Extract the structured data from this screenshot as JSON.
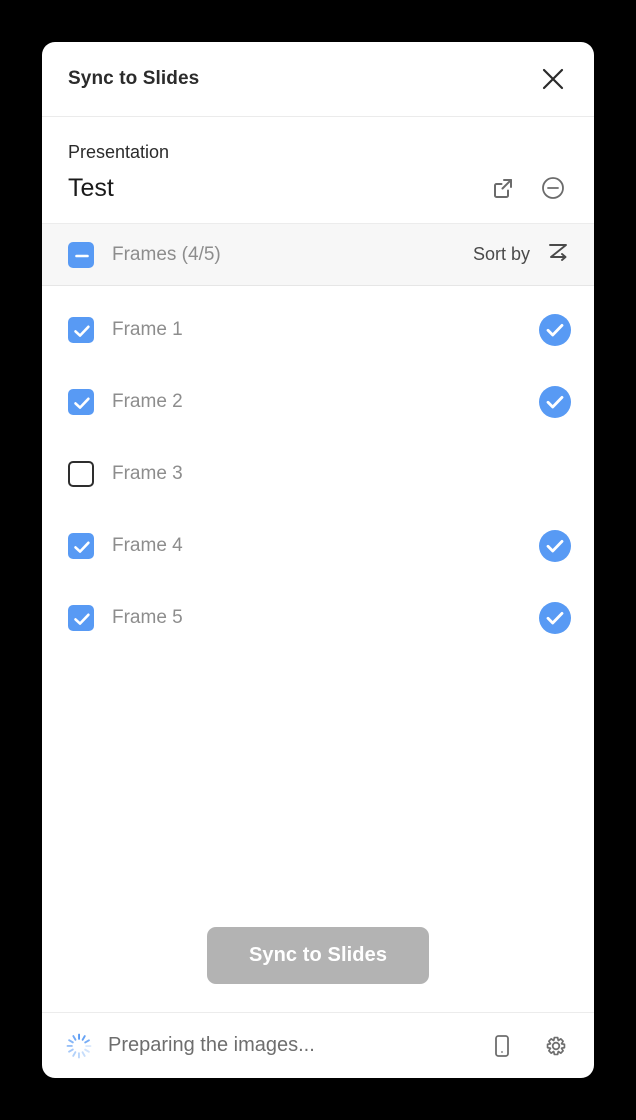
{
  "window": {
    "title": "Sync to Slides",
    "close_icon": "close-icon"
  },
  "presentation": {
    "label": "Presentation",
    "name": "Test",
    "open_external_icon": "external-link-icon",
    "remove_icon": "minus-circle-icon"
  },
  "frames_header": {
    "title": "Frames (4/5)",
    "checkbox_state": "indeterminate",
    "sort_label": "Sort by",
    "sort_icon": "sort-z-arrow-icon"
  },
  "frames": [
    {
      "label": "Frame 1",
      "checked": true,
      "synced": true
    },
    {
      "label": "Frame 2",
      "checked": true,
      "synced": true
    },
    {
      "label": "Frame 3",
      "checked": false,
      "synced": false
    },
    {
      "label": "Frame 4",
      "checked": true,
      "synced": true
    },
    {
      "label": "Frame 5",
      "checked": true,
      "synced": true
    }
  ],
  "action": {
    "sync_label": "Sync to Slides",
    "disabled": true
  },
  "statusbar": {
    "message": "Preparing the images...",
    "spinner_icon": "loading-spinner-icon",
    "device_icon": "mobile-device-icon",
    "settings_icon": "gear-icon"
  },
  "colors": {
    "accent_blue": "#589af4",
    "disabled_button": "#b3b3b3",
    "header_band": "#f7f7f7",
    "muted_text": "#8d8d8d",
    "backdrop": "#000000"
  }
}
